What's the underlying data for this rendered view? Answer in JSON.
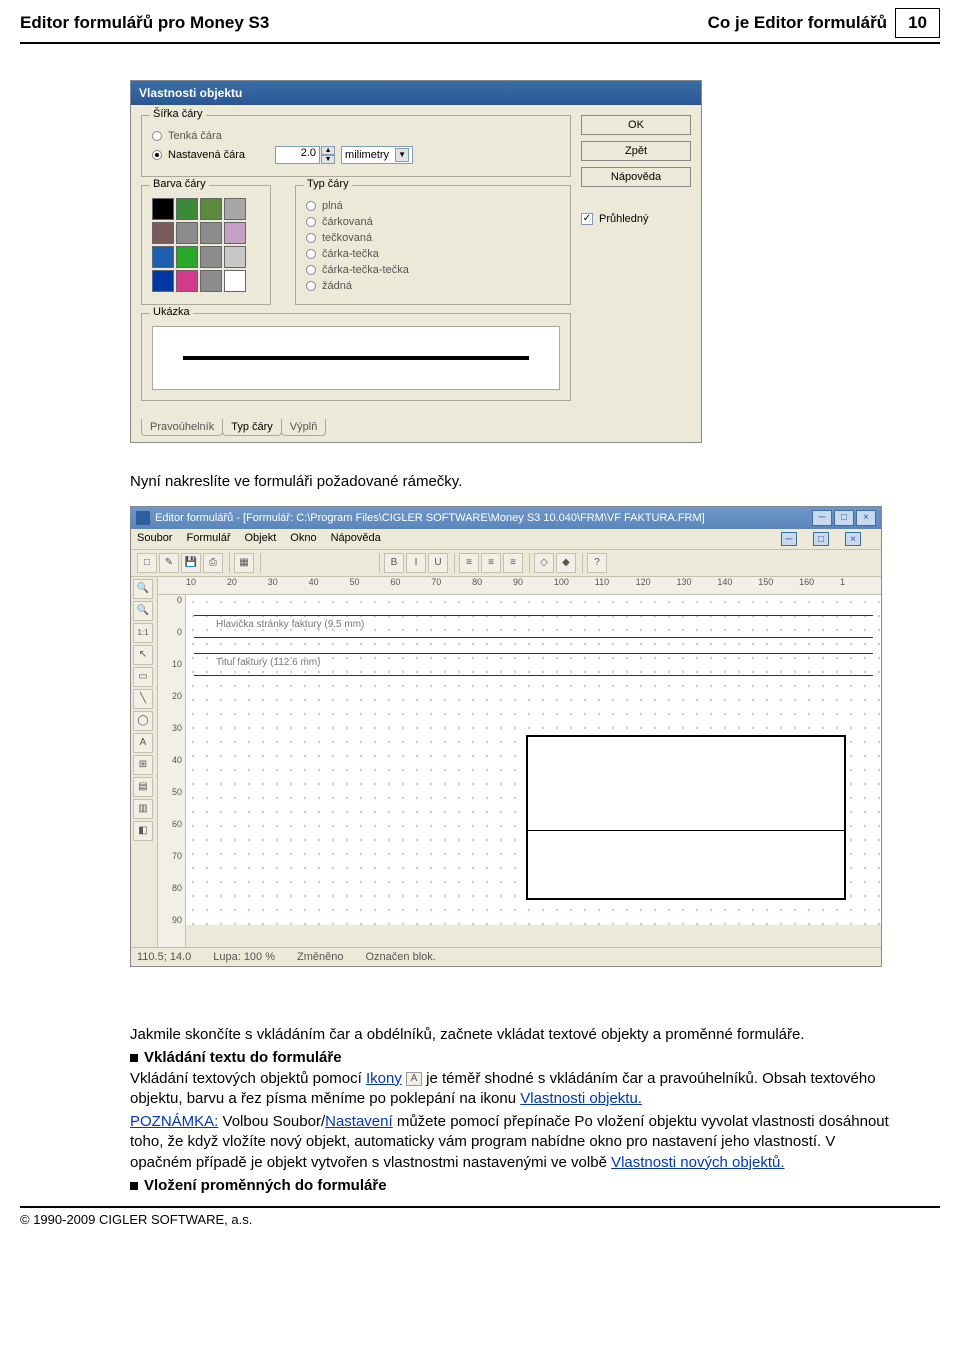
{
  "header": {
    "left": "Editor formulářů pro Money S3",
    "right": "Co je Editor formulářů",
    "page": "10"
  },
  "dlg": {
    "title": "Vlastnosti objektu",
    "group_width": "Šířka čáry",
    "radio_thin": "Tenká čára",
    "radio_set": "Nastavená čára",
    "width_value": "2.0",
    "unit": "milimetry",
    "group_color": "Barva čáry",
    "group_type": "Typ čáry",
    "type_plna": "plná",
    "type_cark": "čárkovaná",
    "type_teck": "tečkovaná",
    "type_ct": "čárka-tečka",
    "type_ctt": "čárka-tečka-tečka",
    "type_zadna": "žádná",
    "group_preview": "Ukázka",
    "btn_ok": "OK",
    "btn_back": "Zpět",
    "btn_help": "Nápověda",
    "chk_transparent": "Průhledný",
    "tab_rect": "Pravoúhelník",
    "tab_line": "Typ čáry",
    "tab_fill": "Výplň"
  },
  "mid_text": "Nyní nakreslíte ve formuláři požadované rámečky.",
  "fe": {
    "title": "Editor formulářů - [Formulář: C:\\Program Files\\CIGLER SOFTWARE\\Money S3 10.040\\FRM\\VF FAKTURA.FRM]",
    "menu": [
      "Soubor",
      "Formulář",
      "Objekt",
      "Okno",
      "Nápověda"
    ],
    "ruler_h": [
      "10",
      "20",
      "30",
      "40",
      "50",
      "60",
      "70",
      "80",
      "90",
      "100",
      "110",
      "120",
      "130",
      "140",
      "150",
      "160",
      "1"
    ],
    "ruler_v": [
      "0",
      "0",
      "10",
      "20",
      "30",
      "40",
      "50",
      "60",
      "70",
      "80",
      "90"
    ],
    "lbl_header": "Hlavička stránky faktury (9.5 mm)",
    "lbl_title": "Titul faktury (112.6 mm)",
    "status_coords": "110.5; 14.0",
    "status_zoom": "Lupa: 100 %",
    "status_changed": "Změněno",
    "status_block": "Označen blok."
  },
  "para": {
    "p1": "Jakmile skončíte s vkládáním čar a obdélníků, začnete vkládat textové objekty a proměnné formuláře.",
    "h1": "Vkládání textu do formuláře",
    "p2a": "Vkládání textových objektů pomocí ",
    "link_ikony": "Ikony",
    "p2b": " je téměř shodné s vkládáním čar a pravoúhelníků. Obsah textového objektu, barvu a řez písma měníme po poklepání na ikonu ",
    "link_vlast": "Vlastnosti objektu.",
    "p3a_label": "POZNÁMKA:",
    "p3a": " Volbou Soubor/",
    "link_nast": "Nastavení",
    "p3b": " můžete pomocí přepínače Po vložení objektu vyvolat vlastnosti dosáhnout toho, že když vložíte nový objekt, automaticky vám program nabídne okno pro nastavení jeho vlastností. V opačném případě je objekt vytvořen s vlastnostmi nastavenými ve volbě ",
    "link_vlast_nov": "Vlastnosti nových objektů.",
    "h2": "Vložení proměnných do formuláře"
  },
  "footer": "© 1990-2009 CIGLER SOFTWARE, a.s."
}
